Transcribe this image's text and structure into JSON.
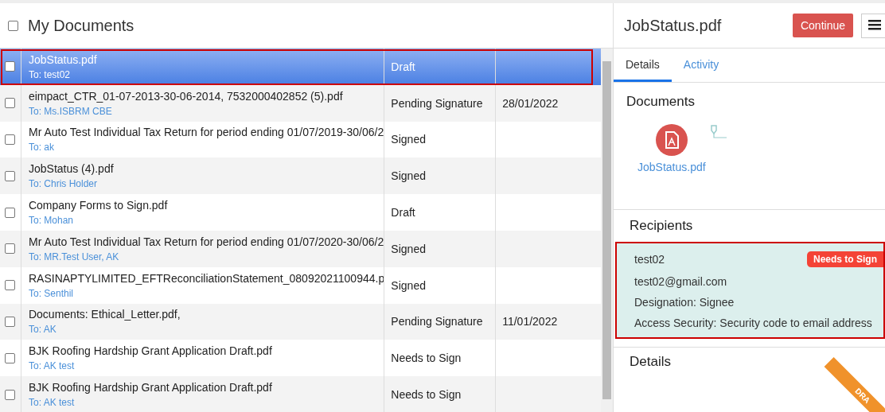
{
  "list": {
    "title": "My Documents",
    "select_all": {
      "checked": false
    },
    "rows": [
      {
        "name": "JobStatus.pdf",
        "to": "To: test02",
        "status": "Draft",
        "date": "",
        "selected": true,
        "checked": false
      },
      {
        "name": "eimpact_CTR_01-07-2013-30-06-2014, 7532000402852 (5).pdf",
        "to": "To: Ms.ISBRM CBE",
        "status": "Pending Signature",
        "date": "28/01/2022",
        "selected": false,
        "checked": false
      },
      {
        "name": "Mr Auto Test Individual Tax Return for period ending 01/07/2019-30/06/2",
        "to": "To: ak",
        "status": "Signed",
        "date": "",
        "selected": false,
        "checked": false
      },
      {
        "name": "JobStatus (4).pdf",
        "to": "To: Chris Holder",
        "status": "Signed",
        "date": "",
        "selected": false,
        "checked": false
      },
      {
        "name": "Company Forms to Sign.pdf",
        "to": "To: Mohan",
        "status": "Draft",
        "date": "",
        "selected": false,
        "checked": false
      },
      {
        "name": "Mr Auto Test Individual Tax Return for period ending 01/07/2020-30/06/2",
        "to": "To: MR.Test User, AK",
        "status": "Signed",
        "date": "",
        "selected": false,
        "checked": false
      },
      {
        "name": "RASINAPTYLIMITED_EFTReconciliationStatement_08092021100944.p",
        "to": "To: Senthil",
        "status": "Signed",
        "date": "",
        "selected": false,
        "checked": false
      },
      {
        "name": "Documents: Ethical_Letter.pdf,",
        "to": "To: AK",
        "status": "Pending Signature",
        "date": "11/01/2022",
        "selected": false,
        "checked": false
      },
      {
        "name": "BJK Roofing Hardship Grant Application Draft.pdf",
        "to": "To: AK test",
        "status": "Needs to Sign",
        "date": "",
        "selected": false,
        "checked": false
      },
      {
        "name": "BJK Roofing Hardship Grant Application Draft.pdf",
        "to": "To: AK test",
        "status": "Needs to Sign",
        "date": "",
        "selected": false,
        "checked": false
      }
    ]
  },
  "detail": {
    "title": "JobStatus.pdf",
    "continue_button": "Continue",
    "tabs": [
      {
        "label": "Details",
        "selected": true
      },
      {
        "label": "Activity",
        "selected": false
      }
    ],
    "documents_heading": "Documents",
    "document": "JobStatus.pdf",
    "recipients_heading": "Recipients",
    "recipient": {
      "name": "test02",
      "badge": "Needs to Sign",
      "email": "test02@gmail.com",
      "designation": "Designation: Signee",
      "access": "Access Security: Security code to email address"
    },
    "details_heading": "Details",
    "ribbon": "DRA"
  }
}
